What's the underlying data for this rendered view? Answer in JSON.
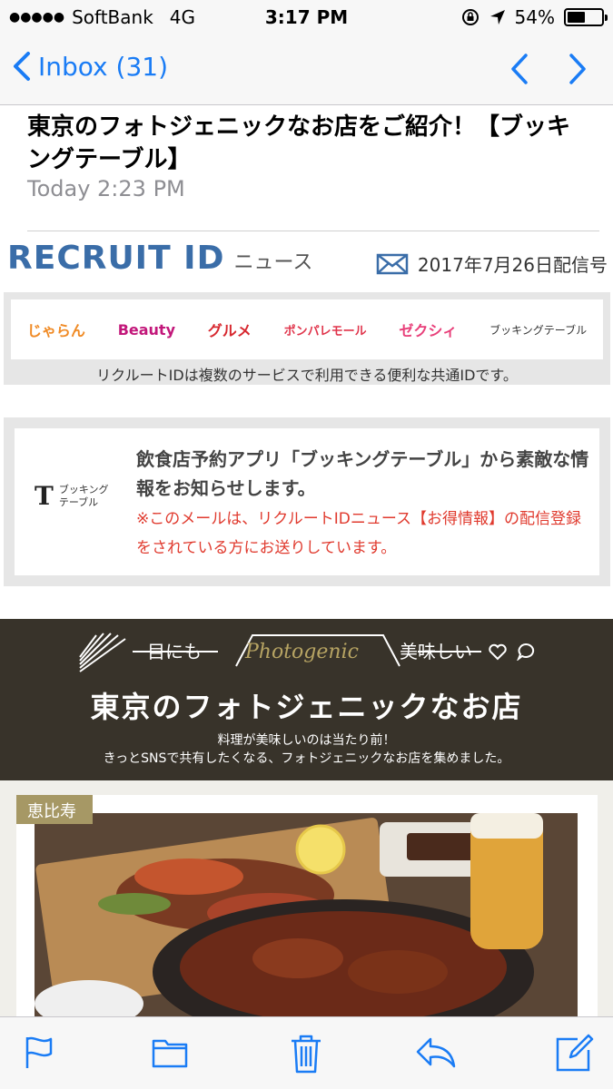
{
  "status_bar": {
    "carrier": "SoftBank",
    "network": "4G",
    "time": "3:17 PM",
    "battery_percent_label": "54%",
    "battery_level": 0.54
  },
  "nav": {
    "back_label": "Inbox (31)"
  },
  "email": {
    "subject": "東京のフォトジェニックなお店をご紹介！【ブッキングテーブル】",
    "date": "Today 2:23 PM"
  },
  "header": {
    "brand": "RECRUIT ID",
    "brand_suffix": "ニュース",
    "issue_date": "2017年7月26日配信号"
  },
  "services": {
    "items": [
      "じゃらん",
      "Beauty",
      "グルメ",
      "ポンパレモール",
      "ゼクシィ",
      "ブッキングテーブル"
    ],
    "note": "リクルートIDは複数のサービスで利用できる便利な共通IDです。"
  },
  "intro": {
    "logo_mark": "T",
    "logo_text_line1": "ブッキング",
    "logo_text_line2": "テーブル",
    "main": "飲食店予約アプリ「ブッキングテーブル」から素敵な情報をお知らせします。",
    "note": "※このメールは、リクルートIDニュース【お得情報】の配信登録をされている方にお送りしています。"
  },
  "banner": {
    "left_word": "目にも",
    "center_word": "Photogenic",
    "right_word": "美味しい",
    "title": "東京のフォトジェニックなお店",
    "sub1": "料理が美味しいのは当たり前！",
    "sub2": "きっとSNSで共有したくなる、フォトジェニックなお店を集めました。"
  },
  "card": {
    "area": "恵比寿"
  },
  "colors": {
    "ios_blue": "#1a7cf5",
    "banner_bg": "#38332a",
    "gold": "#a69865",
    "note_red": "#e03a2e"
  },
  "icons": [
    "back-chevron-icon",
    "prev-message-icon",
    "next-message-icon",
    "location-icon",
    "lock-rotation-icon",
    "mail-icon",
    "flag-icon",
    "folder-icon",
    "trash-icon",
    "reply-icon",
    "compose-icon"
  ]
}
